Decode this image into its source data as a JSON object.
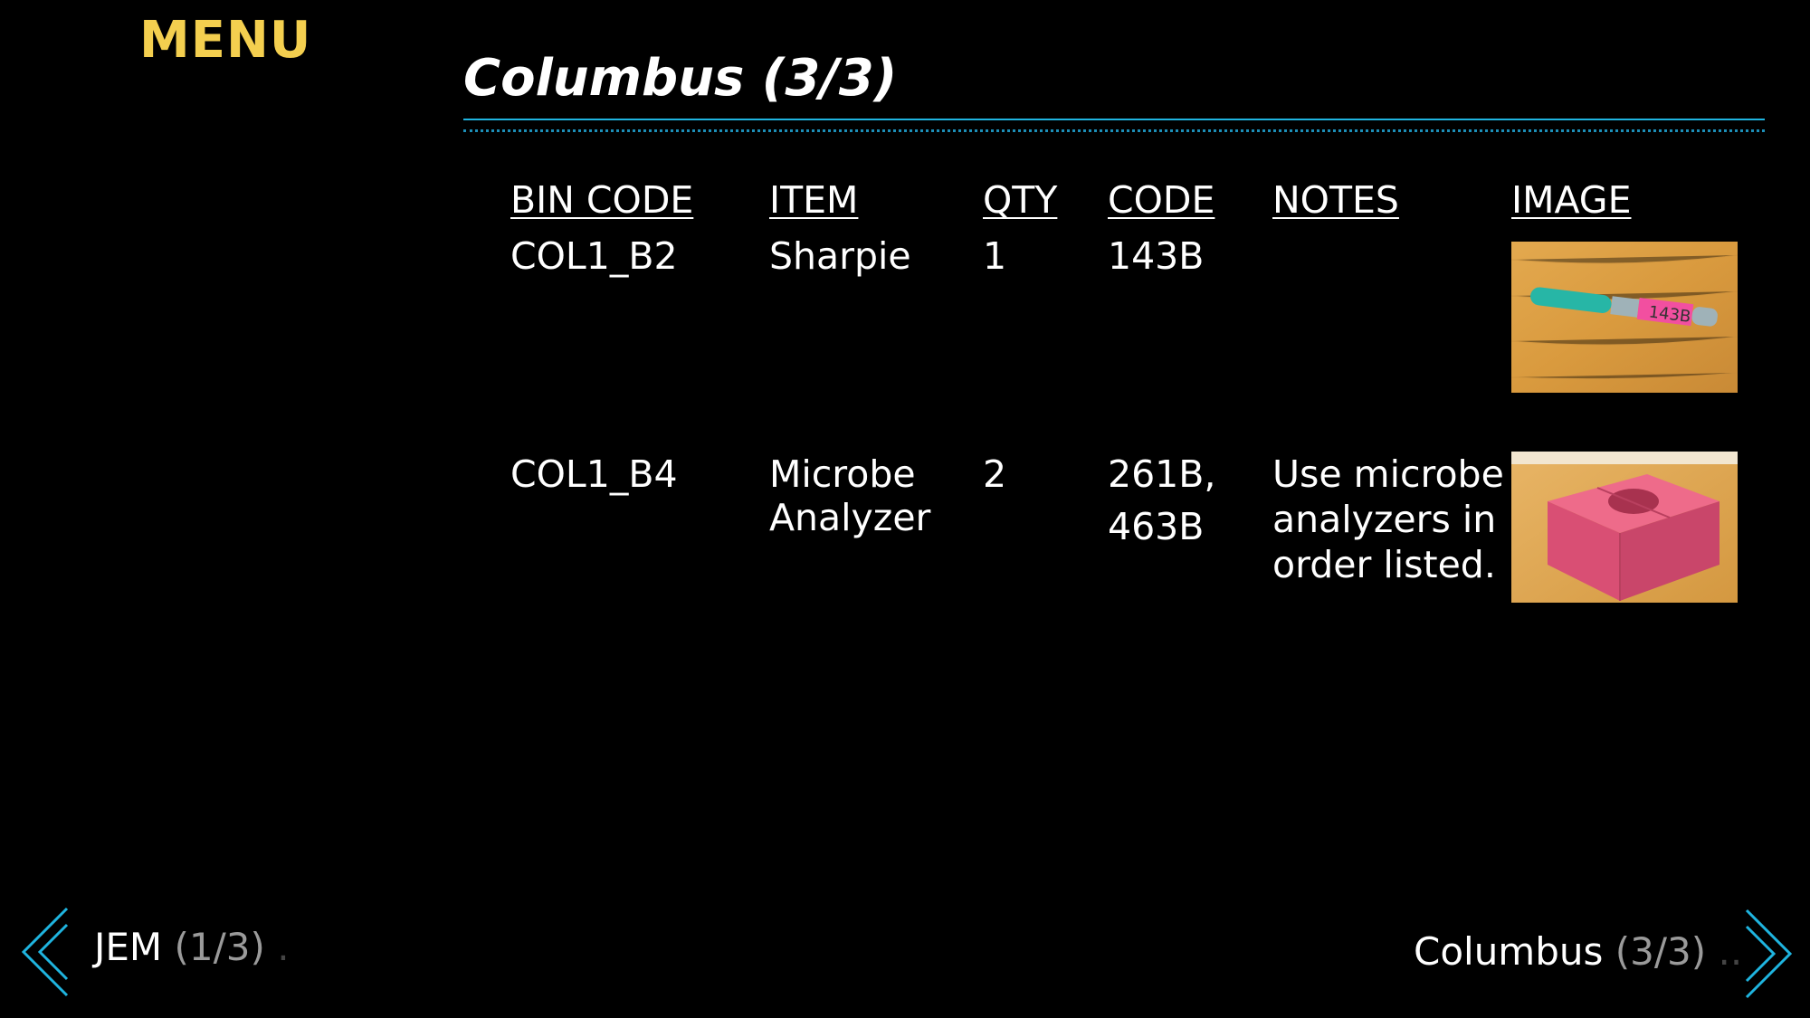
{
  "menu": {
    "label": "MENU"
  },
  "page": {
    "title": "Columbus (3/3)"
  },
  "table": {
    "headers": {
      "bin_code": "BIN CODE",
      "item": "ITEM",
      "qty": "QTY",
      "code": "CODE",
      "notes": "NOTES",
      "image": "IMAGE"
    },
    "rows": [
      {
        "bin_code": "COL1_B2",
        "item": "Sharpie",
        "qty": "1",
        "code_line1": "143B",
        "code_line2": "",
        "notes_line1": "",
        "notes_line2": "",
        "notes_line3": "",
        "image_label": "143B"
      },
      {
        "bin_code": "COL1_B4",
        "item_line1": "Microbe",
        "item_line2": "Analyzer",
        "qty": "2",
        "code_line1": "261B,",
        "code_line2": "463B",
        "notes_line1": "Use microbe",
        "notes_line2": "analyzers in",
        "notes_line3": "order listed."
      }
    ]
  },
  "nav": {
    "prev": {
      "name": "JEM",
      "open": "(",
      "page": "1/3",
      "close": ")",
      "trail": "."
    },
    "next": {
      "name": "Columbus",
      "open": "(",
      "page": "3/3",
      "close": ")",
      "trail": ".."
    }
  },
  "colors": {
    "accent": "#1fb4df",
    "menu": "#f4cf4f",
    "background": "#000000"
  },
  "icons": {
    "prev": "chevron-double-left-icon",
    "next": "chevron-double-right-icon"
  }
}
